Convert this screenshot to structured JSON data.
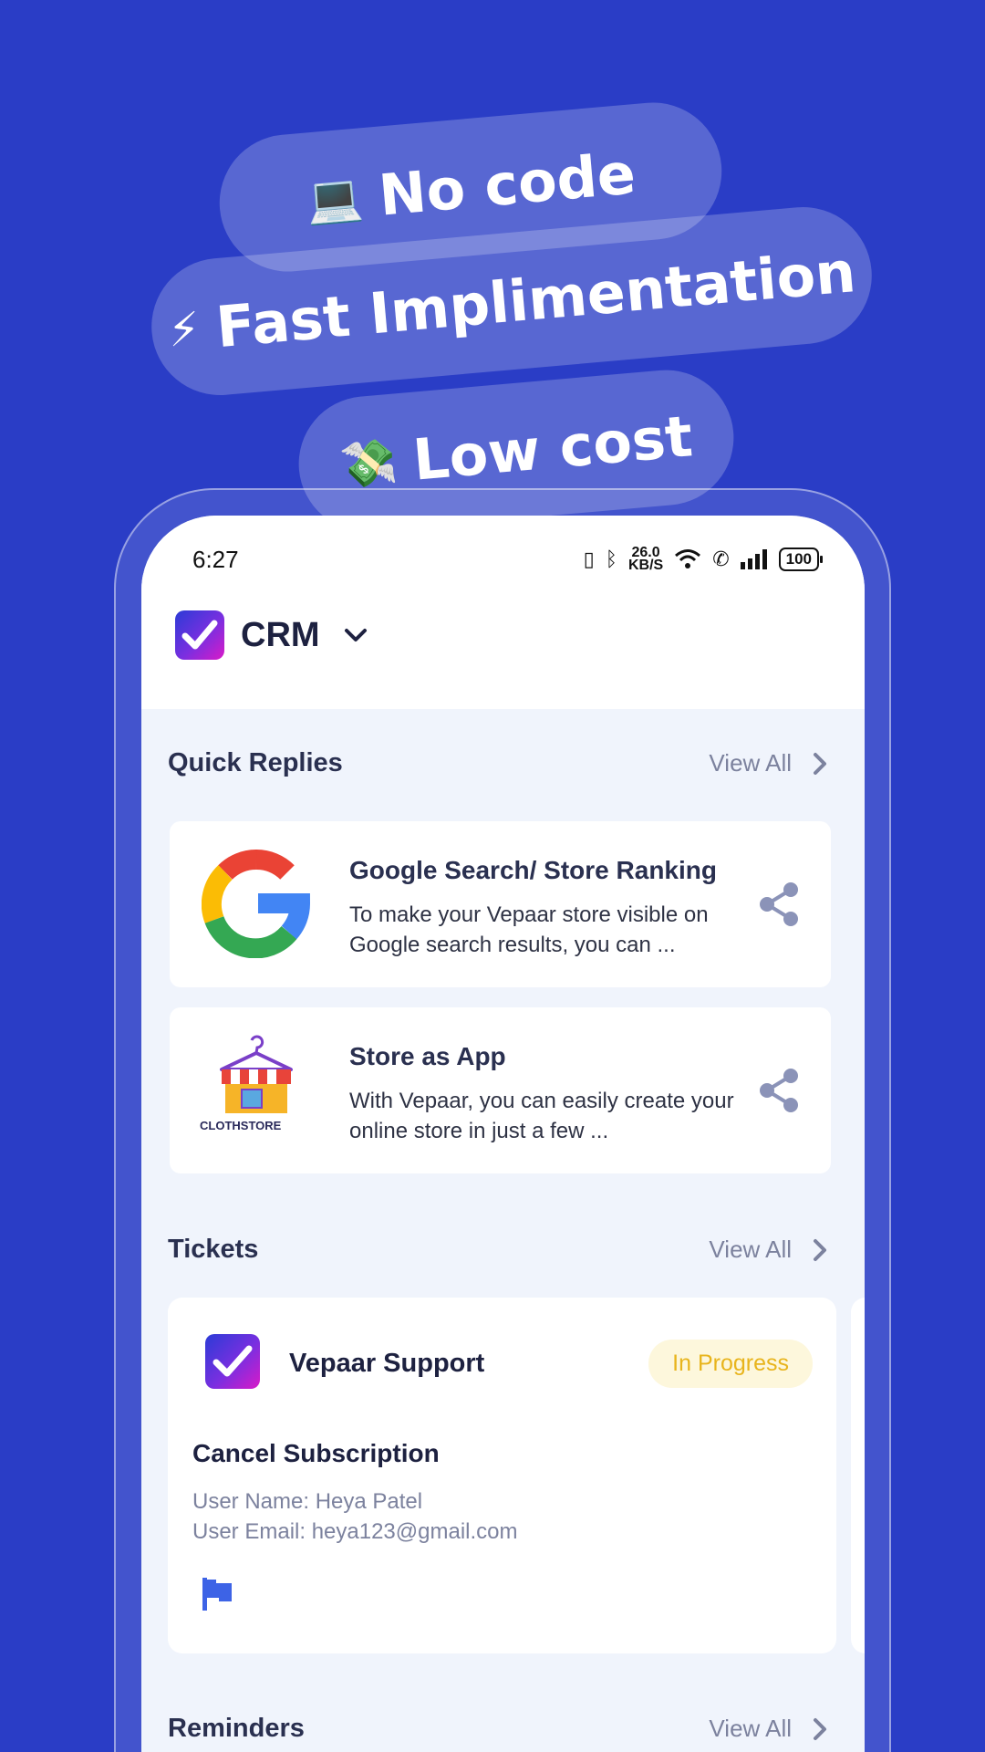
{
  "promo": {
    "pills": [
      {
        "emoji": "💻",
        "label": "No code"
      },
      {
        "emoji": "⚡",
        "label": "Fast Implimentation"
      },
      {
        "emoji": "💸",
        "label": "Low cost"
      }
    ]
  },
  "status_bar": {
    "time": "6:27",
    "net_speed": "26.0",
    "net_unit": "KB/S",
    "battery": "100"
  },
  "header": {
    "app_title": "CRM"
  },
  "quick_replies": {
    "title": "Quick Replies",
    "view_all": "View All",
    "items": [
      {
        "title": "Google Search/ Store Ranking",
        "description": "To make your Vepaar store visible on Google search results, you can ...",
        "thumb": "google-logo"
      },
      {
        "title": "Store as App",
        "description": "With Vepaar, you can easily create your online store in just a few ...",
        "thumb": "clothstore-logo",
        "thumb_text": "CLOTHSTORE"
      }
    ]
  },
  "tickets": {
    "title": "Tickets",
    "view_all": "View All",
    "items": [
      {
        "name": "Vepaar Support",
        "status": "In Progress",
        "subject": "Cancel Subscription",
        "user_name_line": "User Name: Heya Patel",
        "user_email_line": "User Email: heya123@gmail.com",
        "priority_icon": "flag-icon"
      }
    ]
  },
  "reminders": {
    "title": "Reminders",
    "view_all": "View All"
  },
  "colors": {
    "background": "#2a3dc6",
    "screen": "#f0f4fc",
    "status_in_progress": "#e8b41c",
    "flag": "#3d63e6"
  }
}
